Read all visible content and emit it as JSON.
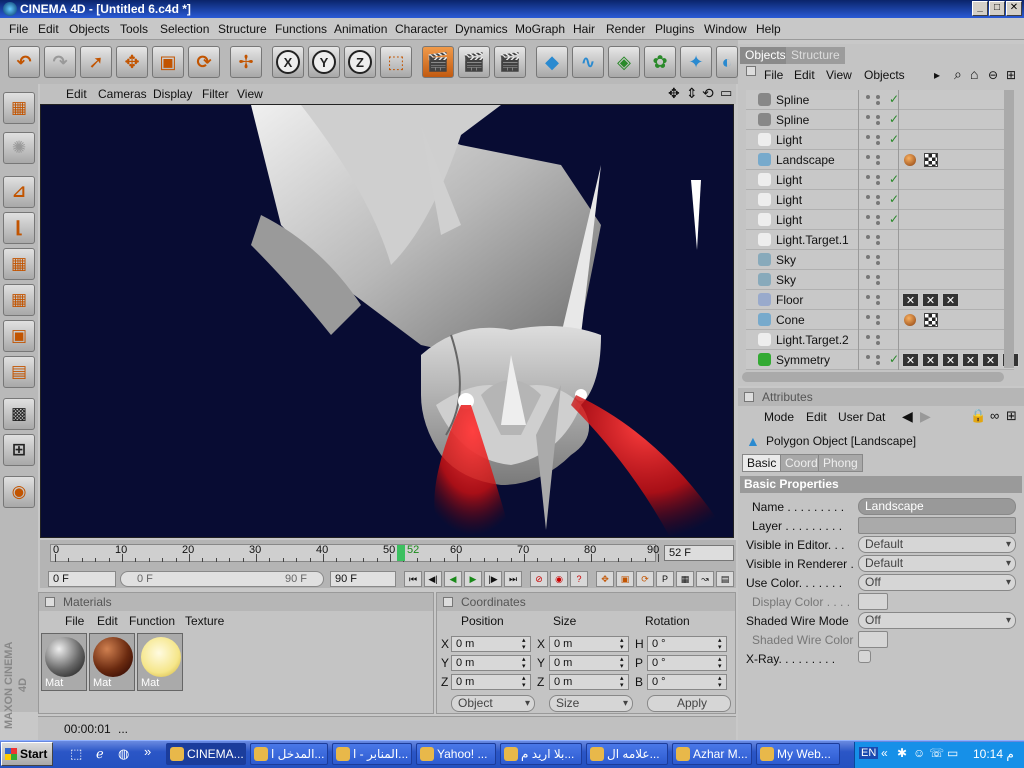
{
  "window": {
    "title": "CINEMA 4D - [Untitled 6.c4d *]",
    "min": "_",
    "max": "□",
    "close": "✕"
  },
  "menu": [
    "File",
    "Edit",
    "Objects",
    "Tools",
    "Selection",
    "Structure",
    "Functions",
    "Animation",
    "Character",
    "Dynamics",
    "MoGraph",
    "Hair",
    "Render",
    "Plugins",
    "Window",
    "Help"
  ],
  "viewport_menu": [
    "Edit",
    "Cameras",
    "Display",
    "Filter",
    "View"
  ],
  "timeline": {
    "ticks": [
      "0",
      "10",
      "20",
      "30",
      "40",
      "50",
      "52",
      "60",
      "70",
      "80",
      "90"
    ],
    "current_frame": "52 F",
    "start_field": "0 F",
    "range_start": "0 F",
    "range_end": "90 F",
    "end_field": "90 F"
  },
  "materials": {
    "title": "Materials",
    "menu": [
      "File",
      "Edit",
      "Function",
      "Texture"
    ],
    "items": [
      {
        "label": "Mat"
      },
      {
        "label": "Mat"
      },
      {
        "label": "Mat"
      }
    ]
  },
  "coordinates": {
    "title": "Coordinates",
    "headers": [
      "Position",
      "Size",
      "Rotation"
    ],
    "rows": [
      {
        "axis": "X",
        "pos": "0 m",
        "saxis": "X",
        "size": "0 m",
        "raxis": "H",
        "rot": "0 °"
      },
      {
        "axis": "Y",
        "pos": "0 m",
        "saxis": "Y",
        "size": "0 m",
        "raxis": "P",
        "rot": "0 °"
      },
      {
        "axis": "Z",
        "pos": "0 m",
        "saxis": "Z",
        "size": "0 m",
        "raxis": "B",
        "rot": "0 °"
      }
    ],
    "mode": "Object",
    "size_mode": "Size",
    "apply": "Apply"
  },
  "status": {
    "time": "00:00:01",
    "message": "..."
  },
  "objects_panel": {
    "tabs": [
      "Objects",
      "Structure"
    ],
    "menu": [
      "File",
      "Edit",
      "View",
      "Objects"
    ],
    "items": [
      {
        "name": "Spline",
        "check": "✓"
      },
      {
        "name": "Spline",
        "check": "✓"
      },
      {
        "name": "Light",
        "check": "✓"
      },
      {
        "name": "Landscape",
        "check": ""
      },
      {
        "name": "Light",
        "check": "✓"
      },
      {
        "name": "Light",
        "check": "✓"
      },
      {
        "name": "Light",
        "check": "✓"
      },
      {
        "name": "Light.Target.1",
        "check": ""
      },
      {
        "name": "Sky",
        "check": ""
      },
      {
        "name": "Sky",
        "check": ""
      },
      {
        "name": "Floor",
        "check": ""
      },
      {
        "name": "Cone",
        "check": ""
      },
      {
        "name": "Light.Target.2",
        "check": ""
      },
      {
        "name": "Symmetry",
        "check": "✓"
      }
    ]
  },
  "attributes": {
    "title": "Attributes",
    "menu": [
      "Mode",
      "Edit",
      "User Dat"
    ],
    "object_title": "Polygon Object [Landscape]",
    "tabs": [
      "Basic",
      "Coord.",
      "Phong"
    ],
    "section": "Basic Properties",
    "fields": [
      {
        "label": "Name . . . . . . . . .",
        "value": "Landscape"
      },
      {
        "label": "Layer . . . . . . . . .",
        "value": ""
      },
      {
        "label": "Visible in Editor. . .",
        "value": "Default"
      },
      {
        "label": "Visible in Renderer .",
        "value": "Default"
      },
      {
        "label": "Use Color. . . . . . .",
        "value": "Off"
      },
      {
        "label": "Display Color . . . .",
        "value": ""
      },
      {
        "label": "Shaded Wire Mode",
        "value": "Off"
      },
      {
        "label": "Shaded Wire Color",
        "value": ""
      },
      {
        "label": "X-Ray. . . . . . . . .",
        "value": ""
      }
    ]
  },
  "taskbar": {
    "start": "Start",
    "tasks": [
      "CINEMA...",
      "المدخل ا...",
      "المنابر - ا...",
      "Yahoo! ...",
      "بلا اريد م...",
      "علامه ال...",
      "Azhar M...",
      "My Web..."
    ],
    "lang": "EN",
    "clock": "10:14 م"
  }
}
